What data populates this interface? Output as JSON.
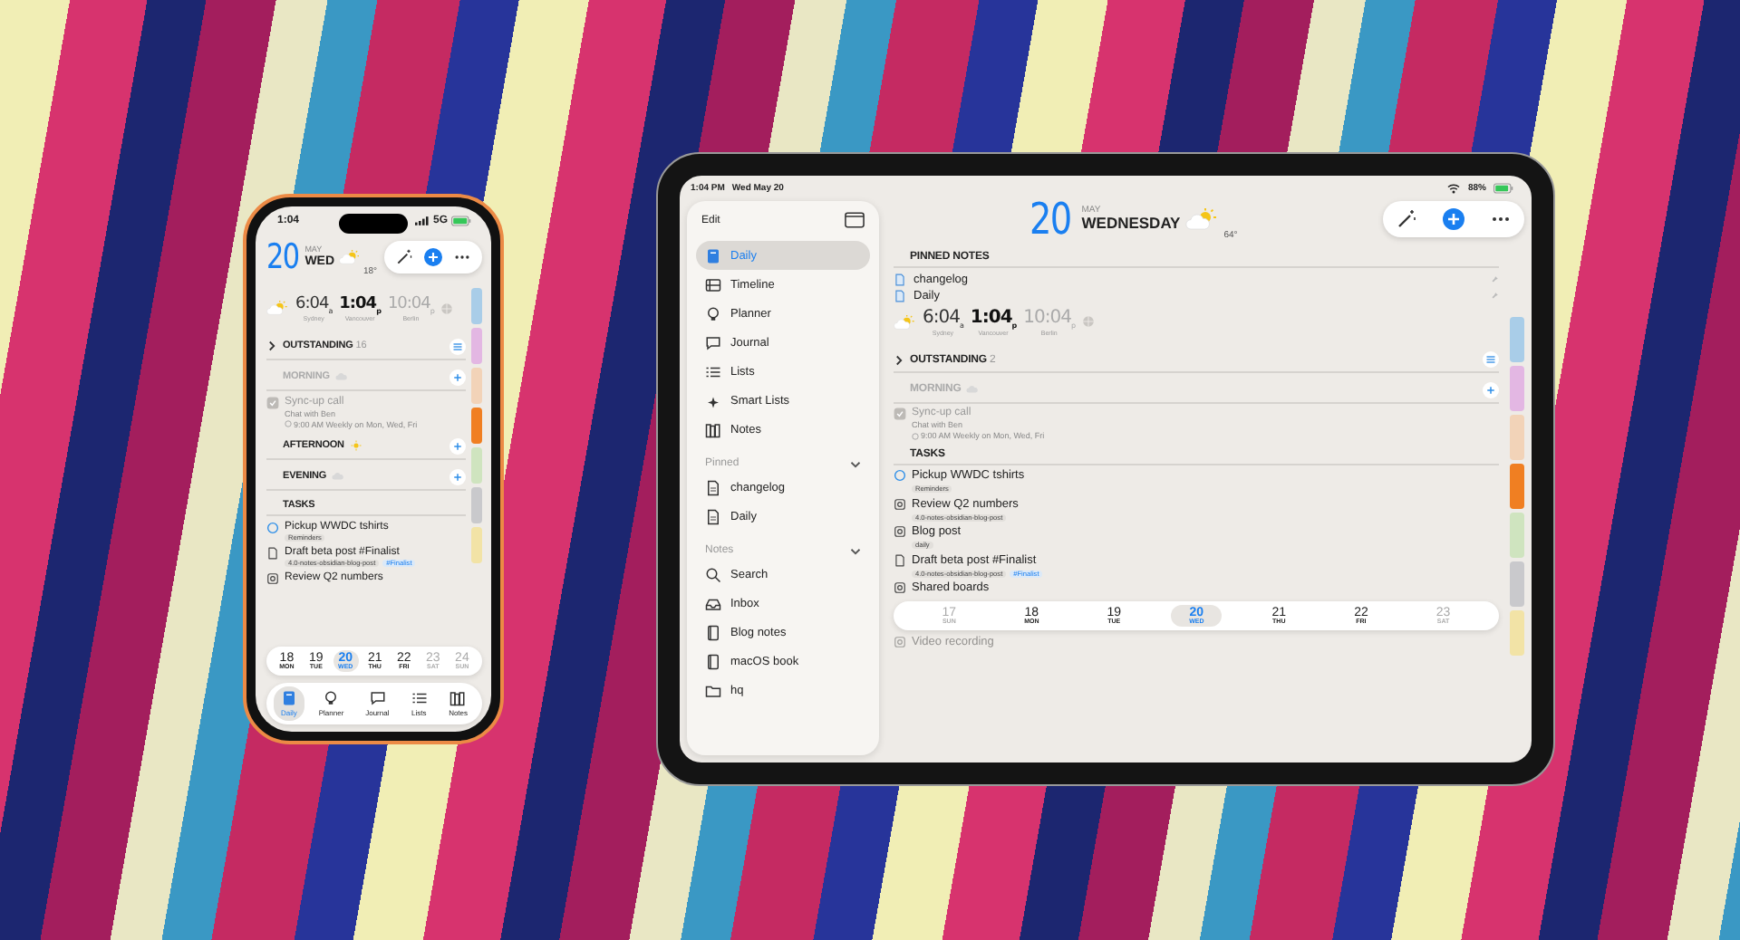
{
  "phone": {
    "status": {
      "time": "1:04",
      "network": "5G"
    },
    "header": {
      "day": "20",
      "month": "MAY",
      "weekday": "WED",
      "temperature": "18°"
    },
    "clocks": [
      {
        "time": "6:04",
        "suffix": "a",
        "city": "Sydney",
        "kind": "normal"
      },
      {
        "time": "1:04",
        "suffix": "p",
        "city": "Vancouver",
        "kind": "current"
      },
      {
        "time": "10:04",
        "suffix": "p",
        "city": "Berlin",
        "kind": "night"
      }
    ],
    "outstanding": {
      "title": "OUTSTANDING",
      "count": "16",
      "expanded": false
    },
    "periods": [
      {
        "title": "MORNING",
        "kind": "cloud",
        "past": true
      },
      {
        "title": "AFTERNOON",
        "kind": "sun",
        "past": false
      },
      {
        "title": "EVENING",
        "kind": "cloud",
        "past": false
      }
    ],
    "event": {
      "title": "Sync-up call",
      "note": "Chat with Ben",
      "schedule": "9:00 AM Weekly on Mon, Wed, Fri",
      "done": true
    },
    "tasks_heading": "TASKS",
    "tasks": [
      {
        "title": "Pickup WWDC tshirts",
        "kind": "reminder",
        "tags": [
          {
            "text": "Reminders",
            "kind": "list"
          }
        ]
      },
      {
        "title": "Draft beta post #Finalist",
        "kind": "note",
        "tags": [
          {
            "text": "4.0-notes-obsidian-blog-post",
            "kind": "note"
          },
          {
            "text": "#Finalist",
            "kind": "tag"
          }
        ]
      },
      {
        "title": "Review Q2 numbers",
        "kind": "board"
      }
    ],
    "date_strip": [
      {
        "number": "18",
        "weekday": "MON",
        "selected": false,
        "dimmed": false
      },
      {
        "number": "19",
        "weekday": "TUE",
        "selected": false,
        "dimmed": false
      },
      {
        "number": "20",
        "weekday": "WED",
        "selected": true,
        "dimmed": false
      },
      {
        "number": "21",
        "weekday": "THU",
        "selected": false,
        "dimmed": false
      },
      {
        "number": "22",
        "weekday": "FRI",
        "selected": false,
        "dimmed": false
      },
      {
        "number": "23",
        "weekday": "SAT",
        "selected": false,
        "dimmed": true
      },
      {
        "number": "24",
        "weekday": "SUN",
        "selected": false,
        "dimmed": true
      }
    ],
    "tab_bar": [
      {
        "label": "Daily",
        "kind": "daily",
        "selected": true
      },
      {
        "label": "Planner",
        "kind": "planner",
        "selected": false
      },
      {
        "label": "Journal",
        "kind": "journal",
        "selected": false
      },
      {
        "label": "Lists",
        "kind": "lists",
        "selected": false
      },
      {
        "label": "Notes",
        "kind": "notes",
        "selected": false
      }
    ],
    "calendar_tabs": [
      {
        "color": "#a9cde8"
      },
      {
        "color": "#e3b7e3"
      },
      {
        "color": "#f2d3b8"
      },
      {
        "color": "#f07f22"
      },
      {
        "color": "#cfe4bf"
      },
      {
        "color": "#c9c9cc"
      },
      {
        "color": "#f2e3a6"
      }
    ]
  },
  "tablet": {
    "status": {
      "time": "1:04 PM",
      "date": "Wed May 20",
      "battery": "88%"
    },
    "sidebar": {
      "edit": "Edit",
      "items": [
        {
          "label": "Daily",
          "kind": "daily",
          "selected": true
        },
        {
          "label": "Timeline",
          "kind": "timeline",
          "selected": false
        },
        {
          "label": "Planner",
          "kind": "planner",
          "selected": false
        },
        {
          "label": "Journal",
          "kind": "journal",
          "selected": false
        },
        {
          "label": "Lists",
          "kind": "lists",
          "selected": false
        },
        {
          "label": "Smart Lists",
          "kind": "smart",
          "selected": false
        },
        {
          "label": "Notes",
          "kind": "notes",
          "selected": false
        }
      ],
      "sections": [
        {
          "title": "Pinned",
          "expanded": true,
          "items": [
            {
              "label": "changelog",
              "kind": "note",
              "selected": false
            },
            {
              "label": "Daily",
              "kind": "note",
              "selected": false
            }
          ]
        },
        {
          "title": "Notes",
          "expanded": true,
          "items": [
            {
              "label": "Search",
              "kind": "search",
              "selected": false
            },
            {
              "label": "Inbox",
              "kind": "inbox",
              "selected": false
            },
            {
              "label": "Blog notes",
              "kind": "book",
              "selected": false
            },
            {
              "label": "macOS book",
              "kind": "book",
              "selected": false
            },
            {
              "label": "hq",
              "kind": "folder",
              "selected": false
            }
          ]
        }
      ]
    },
    "header": {
      "day": "20",
      "month": "MAY",
      "weekday": "WEDNESDAY",
      "temperature": "64°"
    },
    "pinned_notes": {
      "title": "PINNED NOTES",
      "items": [
        "changelog",
        "Daily"
      ]
    },
    "clocks": [
      {
        "time": "6:04",
        "suffix": "a",
        "city": "Sydney",
        "kind": "normal"
      },
      {
        "time": "1:04",
        "suffix": "p",
        "city": "Vancouver",
        "kind": "current"
      },
      {
        "time": "10:04",
        "suffix": "p",
        "city": "Berlin",
        "kind": "night"
      }
    ],
    "outstanding": {
      "title": "OUTSTANDING",
      "count": "2",
      "expanded": false
    },
    "periods": [
      {
        "title": "MORNING",
        "kind": "cloud",
        "past": true
      }
    ],
    "event": {
      "title": "Sync-up call",
      "note": "Chat with Ben",
      "schedule": "9:00 AM Weekly on Mon, Wed, Fri",
      "done": true
    },
    "tasks_heading": "TASKS",
    "tasks": [
      {
        "title": "Pickup WWDC tshirts",
        "kind": "reminder",
        "tags": [
          {
            "text": "Reminders",
            "kind": "list"
          }
        ]
      },
      {
        "title": "Review Q2 numbers",
        "kind": "board",
        "tags": [
          {
            "text": "4.0-notes-obsidian-blog-post",
            "kind": "note"
          }
        ]
      },
      {
        "title": "Blog post",
        "kind": "board",
        "tags": [
          {
            "text": "daily",
            "kind": "note"
          }
        ]
      },
      {
        "title": "Draft beta post #Finalist",
        "kind": "note",
        "tags": [
          {
            "text": "4.0-notes-obsidian-blog-post",
            "kind": "note"
          },
          {
            "text": "#Finalist",
            "kind": "tag"
          }
        ]
      },
      {
        "title": "Shared boards",
        "kind": "board"
      }
    ],
    "date_strip": [
      {
        "number": "17",
        "weekday": "SUN",
        "selected": false,
        "dimmed": true
      },
      {
        "number": "18",
        "weekday": "MON",
        "selected": false,
        "dimmed": false
      },
      {
        "number": "19",
        "weekday": "TUE",
        "selected": false,
        "dimmed": false
      },
      {
        "number": "20",
        "weekday": "WED",
        "selected": true,
        "dimmed": false
      },
      {
        "number": "21",
        "weekday": "THU",
        "selected": false,
        "dimmed": false
      },
      {
        "number": "22",
        "weekday": "FRI",
        "selected": false,
        "dimmed": false
      },
      {
        "number": "23",
        "weekday": "SAT",
        "selected": false,
        "dimmed": true
      }
    ],
    "covered_task": {
      "title": "Video recording",
      "kind": "board"
    },
    "calendar_tabs": [
      {
        "color": "#a9cde8"
      },
      {
        "color": "#e3b7e3"
      },
      {
        "color": "#f2d3b8"
      },
      {
        "color": "#f07f22"
      },
      {
        "color": "#cfe4bf"
      },
      {
        "color": "#c9c9cc"
      },
      {
        "color": "#f2e3a6"
      }
    ]
  }
}
